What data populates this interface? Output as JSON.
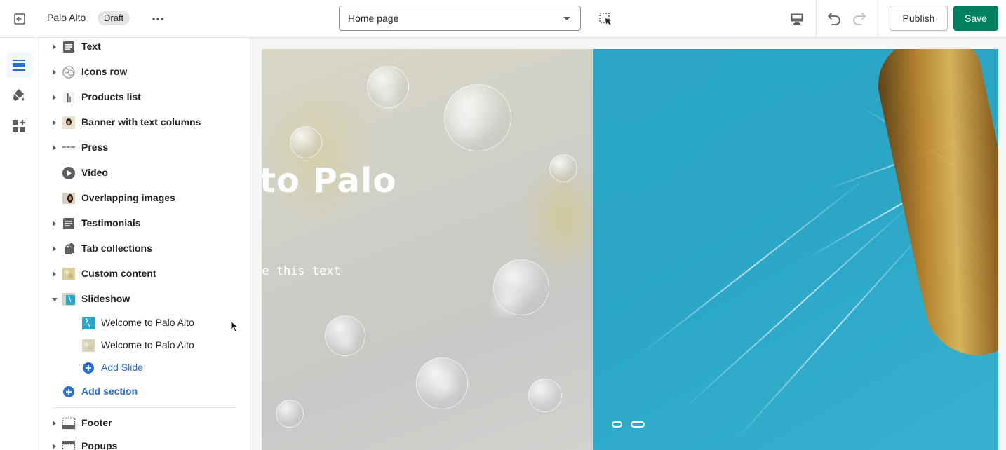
{
  "topbar": {
    "store_name": "Palo Alto",
    "status_badge": "Draft",
    "page_select_value": "Home page",
    "publish_label": "Publish",
    "save_label": "Save"
  },
  "icons": {
    "exit": "exit-icon",
    "more": "more-horizontal-icon",
    "inspect": "select-inspector-icon",
    "desktop": "desktop-preview-icon",
    "undo": "undo-icon",
    "redo": "redo-icon",
    "rail": [
      "sections-icon",
      "theme-settings-icon",
      "apps-icon"
    ]
  },
  "colors": {
    "primary": "#008060",
    "link": "#2c6ecb",
    "rail_active": "#2c6ecb"
  },
  "sections": [
    {
      "label": "Text",
      "expandable": true,
      "icon": "text-block-icon"
    },
    {
      "label": "Icons row",
      "expandable": true,
      "icon": "icons-row-icon"
    },
    {
      "label": "Products list",
      "expandable": true,
      "icon": "products-list-thumbnail"
    },
    {
      "label": "Banner with text columns",
      "expandable": true,
      "icon": "banner-thumbnail"
    },
    {
      "label": "Press",
      "expandable": true,
      "icon": "press-thumbnail"
    },
    {
      "label": "Video",
      "expandable": false,
      "icon": "play-icon"
    },
    {
      "label": "Overlapping images",
      "expandable": false,
      "icon": "overlapping-images-thumbnail"
    },
    {
      "label": "Testimonials",
      "expandable": true,
      "icon": "text-block-icon"
    },
    {
      "label": "Tab collections",
      "expandable": true,
      "icon": "tag-collections-icon"
    },
    {
      "label": "Custom content",
      "expandable": true,
      "icon": "custom-content-thumbnail"
    },
    {
      "label": "Slideshow",
      "expandable": true,
      "expanded": true,
      "icon": "slideshow-thumbnail"
    }
  ],
  "slides": [
    {
      "label": "Welcome to Palo Alto"
    },
    {
      "label": "Welcome to Palo Alto"
    }
  ],
  "add_slide_label": "Add Slide",
  "add_section_label": "Add section",
  "footer_sections": [
    {
      "label": "Footer"
    },
    {
      "label": "Popups"
    }
  ],
  "preview": {
    "slide_title": "to Palo",
    "slide_subtitle": "te this text",
    "slide_count": 2
  }
}
